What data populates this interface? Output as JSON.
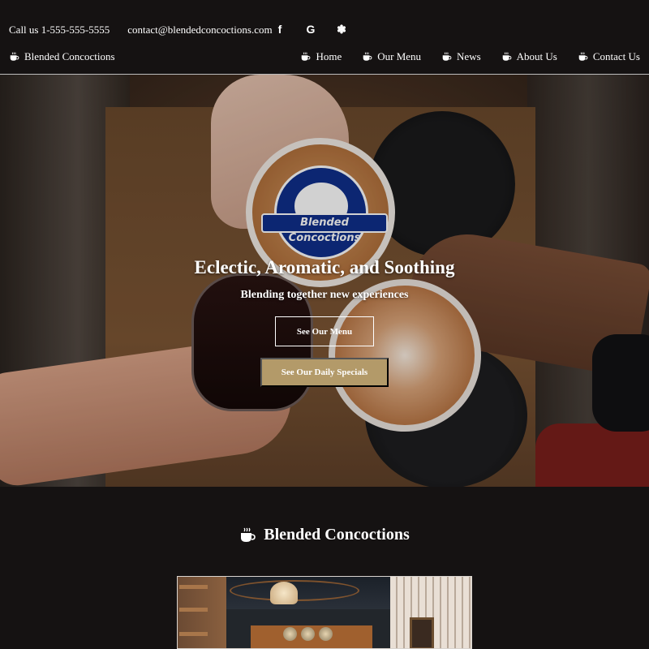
{
  "header": {
    "phone": "Call us 1-555-555-5555",
    "email": "contact@blendedconcoctions.com",
    "social": [
      {
        "name": "facebook-icon",
        "glyph": "f"
      },
      {
        "name": "google-icon",
        "glyph": "G"
      },
      {
        "name": "yelp-icon",
        "glyph": "✽"
      }
    ],
    "brand": "Blended Concoctions",
    "nav": [
      "Home",
      "Our Menu",
      "News",
      "About Us",
      "Contact Us"
    ]
  },
  "hero": {
    "logo_text": "Blended Concoctions",
    "title": "Eclectic, Aromatic, and Soothing",
    "subtitle": "Blending together new experiences",
    "primary_button": "See Our Menu",
    "secondary_button": "See Our Daily Specials"
  },
  "section": {
    "title": "Blended Concoctions"
  },
  "colors": {
    "background": "#151212",
    "accent_gold": "#b39a69",
    "logo_blue": "#0f2f8c",
    "text": "#ffffff"
  }
}
